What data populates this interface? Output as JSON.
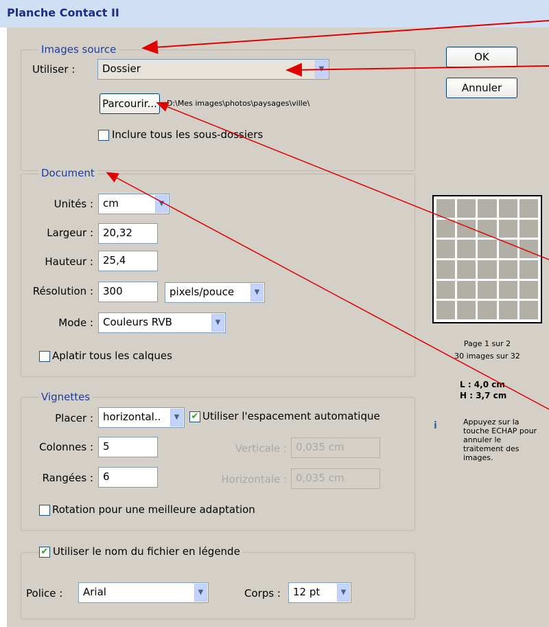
{
  "window": {
    "title": "Planche Contact II"
  },
  "buttons": {
    "ok": "OK",
    "cancel": "Annuler"
  },
  "source": {
    "legend": "Images source",
    "use_label": "Utiliser :",
    "use_value": "Dossier",
    "browse": "Parcourir...",
    "path": "D:\\Mes images\\photos\\paysages\\ville\\",
    "subfolders_label": "Inclure tous les sous-dossiers",
    "subfolders_checked": false
  },
  "document": {
    "legend": "Document",
    "units_label": "Unités :",
    "units_value": "cm",
    "width_label": "Largeur :",
    "width_value": "20,32",
    "height_label": "Hauteur :",
    "height_value": "25,4",
    "resolution_label": "Résolution :",
    "resolution_value": "300",
    "resolution_unit": "pixels/pouce",
    "mode_label": "Mode :",
    "mode_value": "Couleurs RVB",
    "flatten_label": "Aplatir tous les calques",
    "flatten_checked": false
  },
  "thumbnails": {
    "legend": "Vignettes",
    "place_label": "Placer :",
    "place_value": "horizontal..",
    "auto_spacing_label": "Utiliser l'espacement automatique",
    "auto_spacing_checked": true,
    "columns_label": "Colonnes :",
    "columns_value": "5",
    "rows_label": "Rangées :",
    "rows_value": "6",
    "vertical_label": "Verticale :",
    "vertical_value": "0,035 cm",
    "horizontal_label": "Horizontale :",
    "horizontal_value": "0,035 cm",
    "rotate_label": "Rotation pour une meilleure adaptation",
    "rotate_checked": false
  },
  "caption": {
    "legend": "Utiliser le nom du fichier en légende",
    "checked": true,
    "font_label": "Police :",
    "font_value": "Arial",
    "size_label": "Corps :",
    "size_value": "12 pt"
  },
  "preview": {
    "page": "Page 1 sur 2",
    "images": "30 images sur 32",
    "dim_l": "L : 4,0 cm",
    "dim_h": "H : 3,7 cm",
    "tip": "Appuyez sur la touche ECHAP pour annuler le traitement des images.",
    "grid_columns": 5,
    "grid_rows": 6
  },
  "icons": {
    "info": "info-icon",
    "dropdown": "chevron-down-icon",
    "check": "checkmark-icon"
  },
  "colors": {
    "title_text": "#1d2c86",
    "legend_text": "#1f3c9b",
    "dialog_bg": "#d4d0c8",
    "annotation": "#e00000"
  }
}
